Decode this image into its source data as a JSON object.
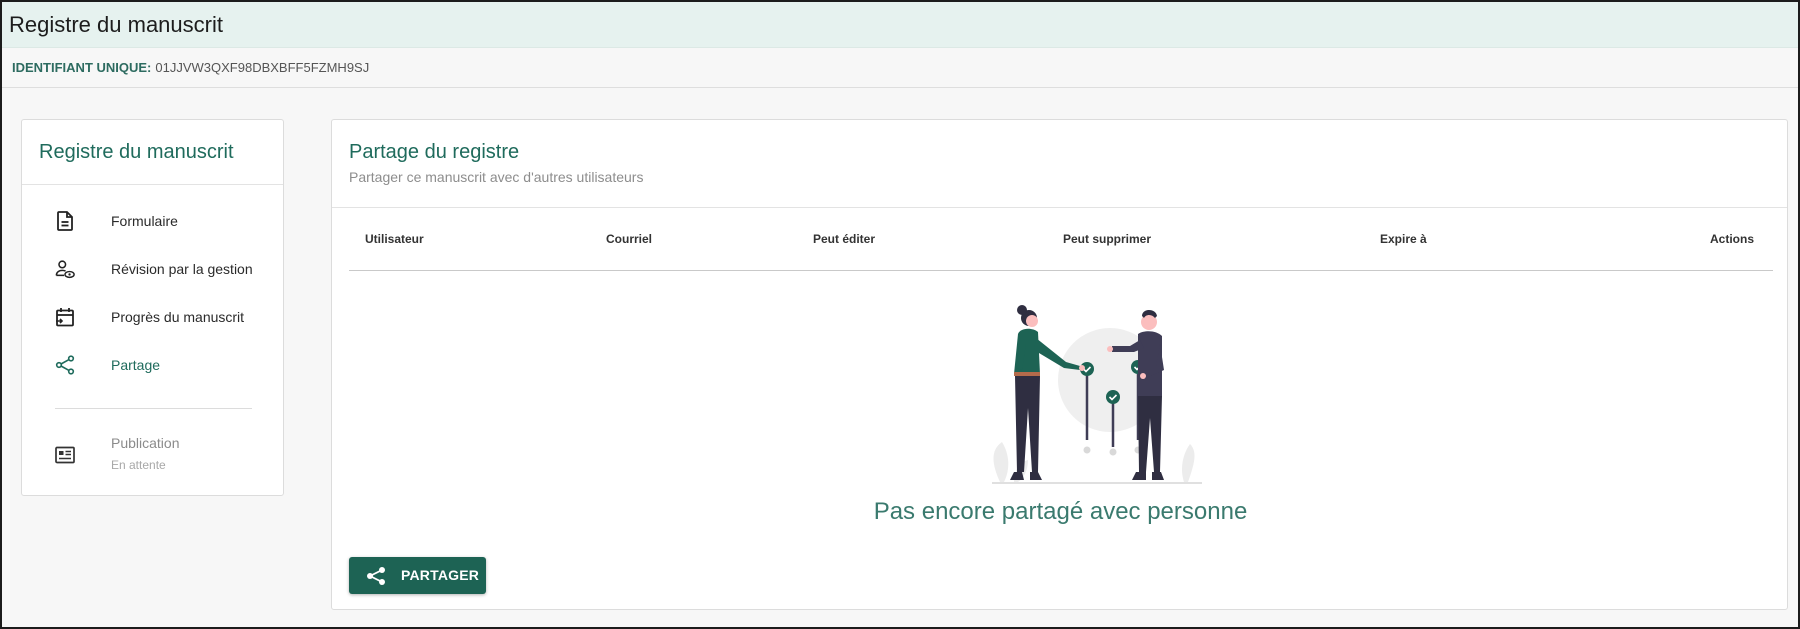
{
  "app": {
    "title": "Registre du manuscrit"
  },
  "identifier": {
    "label": "IDENTIFIANT UNIQUE:",
    "value": "01JJVW3QXF98DBXBFF5FZMH9SJ"
  },
  "sidebar": {
    "title": "Registre du manuscrit",
    "items": [
      {
        "label": "Formulaire",
        "icon": "document-icon"
      },
      {
        "label": "Révision par la gestion",
        "icon": "user-review-icon"
      },
      {
        "label": "Progrès du manuscrit",
        "icon": "calendar-progress-icon"
      },
      {
        "label": "Partage",
        "icon": "share-icon",
        "active": true
      }
    ],
    "publication": {
      "label": "Publication",
      "status": "En attente",
      "icon": "newspaper-icon"
    }
  },
  "panel": {
    "title": "Partage du registre",
    "subtitle": "Partager ce manuscrit avec d'autres utilisateurs",
    "columns": [
      "Utilisateur",
      "Courriel",
      "Peut éditer",
      "Peut supprimer",
      "Expire à",
      "Actions"
    ],
    "empty_message": "Pas encore partagé avec personne",
    "share_button": "PARTAGER"
  },
  "colors": {
    "accent": "#1f6b5c",
    "header_bg": "#e6f2ef",
    "button_bg": "#1d6354"
  }
}
